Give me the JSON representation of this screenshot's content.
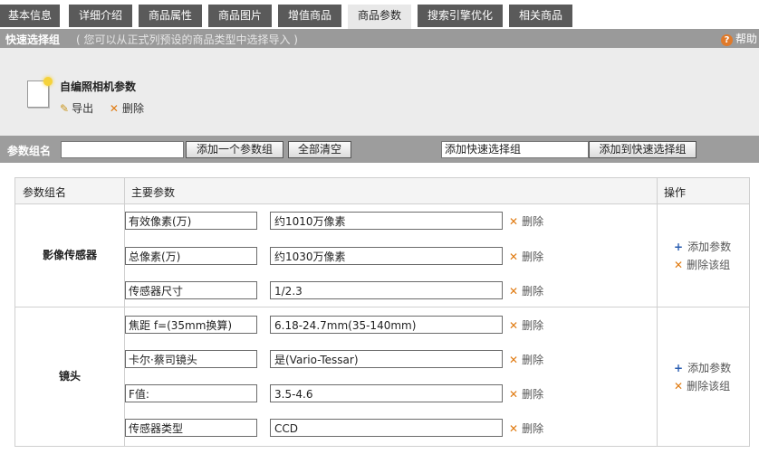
{
  "tabs": [
    {
      "label": "基本信息",
      "active": false
    },
    {
      "label": "详细介绍",
      "active": false
    },
    {
      "label": "商品属性",
      "active": false
    },
    {
      "label": "商品图片",
      "active": false
    },
    {
      "label": "增值商品",
      "active": false
    },
    {
      "label": "商品参数",
      "active": true
    },
    {
      "label": "搜索引擎优化",
      "active": false
    },
    {
      "label": "相关商品",
      "active": false
    }
  ],
  "quick_select": {
    "title": "快速选择组",
    "hint": "( 您可以从正式列预设的商品类型中选择导入 )",
    "help_label": "帮助",
    "preset": {
      "name": "自编照相机参数",
      "export_label": "导出",
      "delete_label": "删除"
    }
  },
  "group_bar": {
    "label": "参数组名",
    "input_value": "",
    "add_group_button": "添加一个参数组",
    "clear_all_button": "全部清空",
    "quick_group_input": "添加快速选择组",
    "add_to_quick_button": "添加到快速选择组"
  },
  "table": {
    "headers": {
      "group": "参数组名",
      "params": "主要参数",
      "ops": "操作"
    },
    "groups": [
      {
        "name": "影像传感器",
        "params": [
          {
            "name": "有效像素(万)",
            "value": "约1010万像素"
          },
          {
            "name": "总像素(万)",
            "value": "约1030万像素"
          },
          {
            "name": "传感器尺寸",
            "value": "1/2.3"
          }
        ]
      },
      {
        "name": "镜头",
        "params": [
          {
            "name": "焦距  f=(35mm换算)",
            "value": "6.18-24.7mm(35-140mm)"
          },
          {
            "name": "卡尔·蔡司镜头",
            "value": "是(Vario-Tessar)"
          },
          {
            "name": "F值:",
            "value": "3.5-4.6"
          },
          {
            "name": "传感器类型",
            "value": "CCD"
          }
        ]
      }
    ],
    "delete_label": "删除",
    "add_param_label": "添加参数",
    "delete_group_label": "删除该组"
  }
}
